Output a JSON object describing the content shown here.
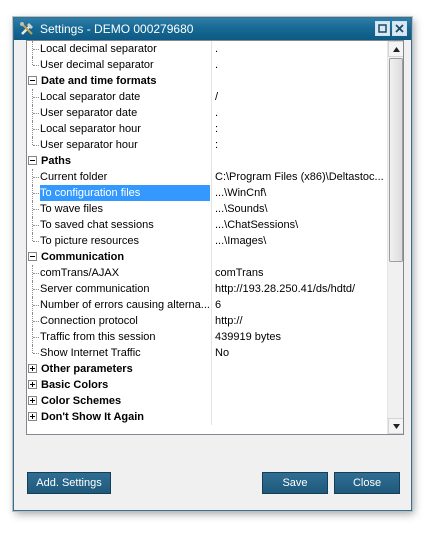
{
  "window": {
    "title": "Settings - DEMO 000279680",
    "accent": "#176a95"
  },
  "grid": {
    "rows": [
      {
        "type": "item",
        "name": "Local decimal separator",
        "value": "."
      },
      {
        "type": "item",
        "name": "User decimal separator",
        "value": ".",
        "last": true
      },
      {
        "type": "cat",
        "name": "Date and time formats",
        "expanded": true
      },
      {
        "type": "item",
        "name": "Local separator date",
        "value": "/"
      },
      {
        "type": "item",
        "name": "User separator date",
        "value": "."
      },
      {
        "type": "item",
        "name": "Local separator hour",
        "value": ":"
      },
      {
        "type": "item",
        "name": "User separator hour",
        "value": ":",
        "last": true
      },
      {
        "type": "cat",
        "name": "Paths",
        "expanded": true
      },
      {
        "type": "item",
        "name": "Current folder",
        "value": "C:\\Program Files (x86)\\Deltastoc..."
      },
      {
        "type": "item",
        "name": "To configuration files",
        "value": "...\\WinCnf\\",
        "selected": true
      },
      {
        "type": "item",
        "name": "To wave files",
        "value": "...\\Sounds\\"
      },
      {
        "type": "item",
        "name": "To saved chat sessions",
        "value": "...\\ChatSessions\\"
      },
      {
        "type": "item",
        "name": "To picture resources",
        "value": "...\\Images\\",
        "last": true
      },
      {
        "type": "cat",
        "name": "Communication",
        "expanded": true
      },
      {
        "type": "item",
        "name": "comTrans/AJAX",
        "value": "comTrans"
      },
      {
        "type": "item",
        "name": "Server communication",
        "value": "http://193.28.250.41/ds/hdtd/"
      },
      {
        "type": "item",
        "name": "Number of errors causing alterna...",
        "value": "6"
      },
      {
        "type": "item",
        "name": "Connection protocol",
        "value": "http://"
      },
      {
        "type": "item",
        "name": "Traffic from this session",
        "value": "439919 bytes"
      },
      {
        "type": "item",
        "name": "Show Internet Traffic",
        "value": "No",
        "last": true
      },
      {
        "type": "cat",
        "name": "Other parameters",
        "expanded": false
      },
      {
        "type": "cat",
        "name": "Basic Colors",
        "expanded": false
      },
      {
        "type": "cat",
        "name": "Color Schemes",
        "expanded": false
      },
      {
        "type": "cat",
        "name": "Don't Show It Again",
        "expanded": false
      }
    ],
    "selection_color": "#3399ff",
    "scroll_position": 0.2
  },
  "buttons": {
    "add_settings": "Add. Settings",
    "save": "Save",
    "close": "Close"
  },
  "icons": {
    "app": "tools-icon",
    "maximize": "restore-icon",
    "close": "close-icon",
    "scroll_up": "triangle-up-icon",
    "scroll_down": "triangle-down-icon"
  }
}
